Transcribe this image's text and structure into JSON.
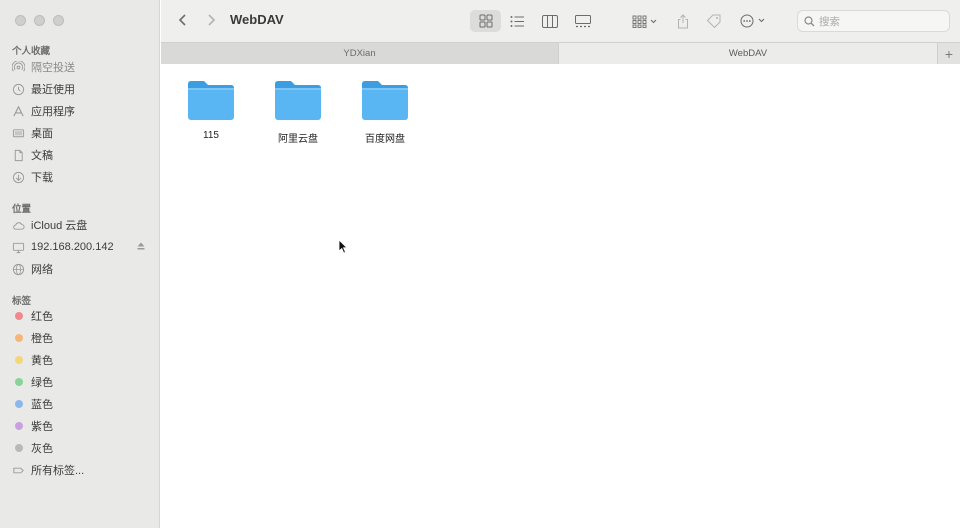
{
  "window": {
    "title": "WebDAV"
  },
  "sidebar": {
    "favorites_heading": "个人收藏",
    "favorites": [
      {
        "label": "隔空投送",
        "icon": "airdrop-icon"
      },
      {
        "label": "最近使用",
        "icon": "clock-icon"
      },
      {
        "label": "应用程序",
        "icon": "applications-icon"
      },
      {
        "label": "桌面",
        "icon": "desktop-icon"
      },
      {
        "label": "文稿",
        "icon": "document-icon"
      },
      {
        "label": "下载",
        "icon": "download-icon"
      }
    ],
    "locations_heading": "位置",
    "locations": [
      {
        "label": "iCloud 云盘",
        "icon": "cloud-icon"
      },
      {
        "label": "192.168.200.142",
        "icon": "display-icon"
      },
      {
        "label": "网络",
        "icon": "network-icon"
      }
    ],
    "tags_heading": "标签",
    "tags": [
      {
        "label": "红色",
        "color": "#f08a8a"
      },
      {
        "label": "橙色",
        "color": "#f5b67a"
      },
      {
        "label": "黄色",
        "color": "#f3d77a"
      },
      {
        "label": "绿色",
        "color": "#86d496"
      },
      {
        "label": "蓝色",
        "color": "#8ab8ec"
      },
      {
        "label": "紫色",
        "color": "#c9a1e0"
      },
      {
        "label": "灰色",
        "color": "#b9b9b9"
      }
    ],
    "all_tags": "所有标签..."
  },
  "toolbar": {
    "search_placeholder": "搜索"
  },
  "tabs": [
    {
      "label": "YDXian"
    },
    {
      "label": "WebDAV"
    }
  ],
  "tab_add": "+",
  "folders": [
    {
      "name": "115"
    },
    {
      "name": "阿里云盘"
    },
    {
      "name": "百度网盘"
    }
  ],
  "colors": {
    "folder": "#5ab6f2",
    "folder_tab": "#3c9ee0"
  }
}
